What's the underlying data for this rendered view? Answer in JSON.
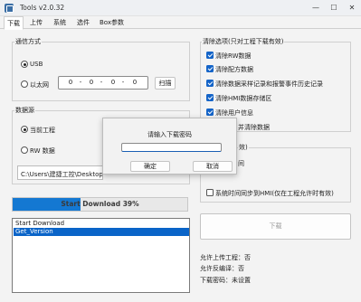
{
  "window": {
    "title": "Tools v2.0.32",
    "minimize": "—",
    "maximize": "☐",
    "close": "✕"
  },
  "tabs": [
    {
      "label": "下载",
      "active": true
    },
    {
      "label": "上传",
      "active": false
    },
    {
      "label": "系统",
      "active": false
    },
    {
      "label": "选件",
      "active": false
    },
    {
      "label": "Box参数",
      "active": false
    }
  ],
  "comm": {
    "title": "通信方式",
    "usb_label": "USB",
    "ethernet_label": "以太网",
    "ip": [
      "0",
      "0",
      "0",
      "0"
    ],
    "scan_label": "扫描"
  },
  "data_source": {
    "title": "数据源",
    "current_project_label": "当前工程",
    "rw_data_label": "RW 数据",
    "path": "C:\\Users\\建捷工控\\Desktop\\20"
  },
  "progress": {
    "text": "Start Download 39%",
    "percent": 39
  },
  "log": {
    "lines": [
      "Start Download",
      "Get_Version"
    ],
    "selected_index": 1
  },
  "clear_options": {
    "title": "清除选项(只对工程下载有效)",
    "items": [
      {
        "label": "清除RW数据",
        "checked": true
      },
      {
        "label": "清除配方数据",
        "checked": true
      },
      {
        "label": "清除数据采样记录和报警事件历史记录",
        "checked": true
      },
      {
        "label": "清除HMI数据存储区",
        "checked": true
      },
      {
        "label": "清除用户信息",
        "checked": true
      }
    ],
    "partial_item_label": "并清除数据"
  },
  "sync": {
    "partial_title": "效)",
    "partial_label": "间",
    "time_sync_label": "系统时间同步到HMI(仅在工程允许时有效)",
    "time_sync_checked": false
  },
  "download_button": "下载",
  "info": {
    "allow_upload": "允许上传工程：否",
    "allow_decompile": "允许反编译：否",
    "download_password": "下载密码：未设置"
  },
  "dialog": {
    "prompt": "请输入下载密码",
    "input_value": "",
    "ok_label": "确定",
    "cancel_label": "取消"
  }
}
